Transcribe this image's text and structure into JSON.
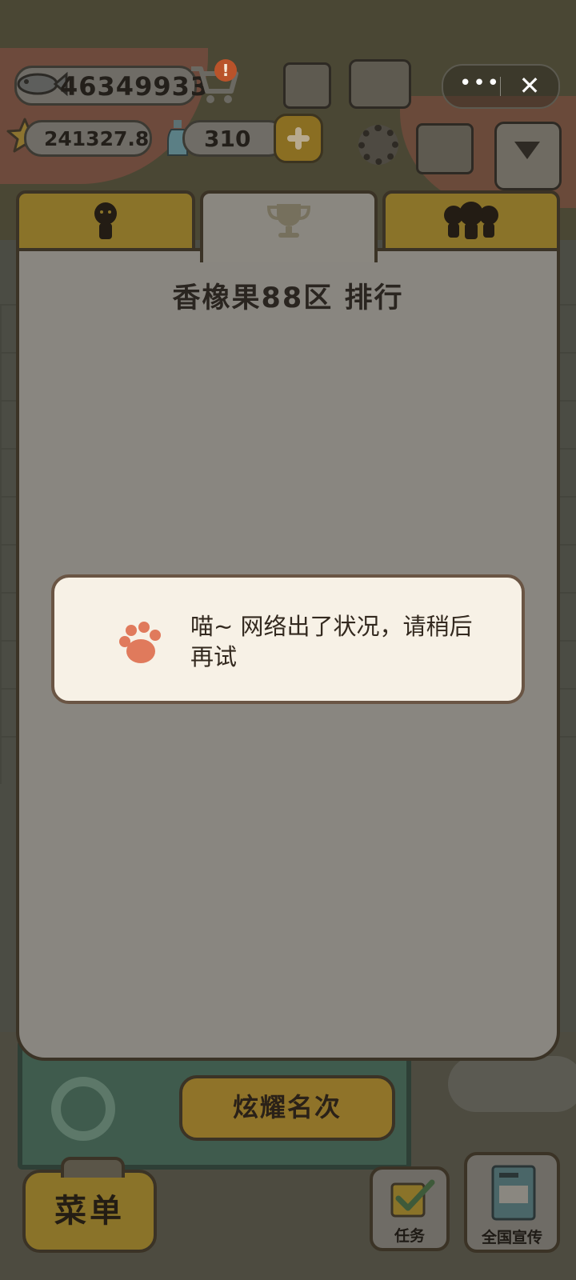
{
  "hud": {
    "fish_count": "46349933",
    "star_count": "241327.8",
    "bottle_count": "310",
    "cart_badge": "!"
  },
  "capsule": {
    "more_label": "•••",
    "close_label": "✕"
  },
  "ranking": {
    "tabs": [
      {
        "icon": "person-icon",
        "active": false
      },
      {
        "icon": "trophy-icon",
        "active": true
      },
      {
        "icon": "group-icon",
        "active": false
      }
    ],
    "title": "香橡果88区 排行",
    "show_rank_button": "炫耀名次"
  },
  "toast": {
    "icon": "paw-icon",
    "message": "喵~ 网络出了状况，请稍后再试"
  },
  "bottom": {
    "menu_label": "菜单",
    "task_label": "任务",
    "promo_label": "全国宣传"
  },
  "colors": {
    "panel": "#898680",
    "tab_gold": "#8a7329",
    "toast_bg": "#f7f1e6",
    "paw": "#e07a5c",
    "outline": "#3b3326"
  }
}
